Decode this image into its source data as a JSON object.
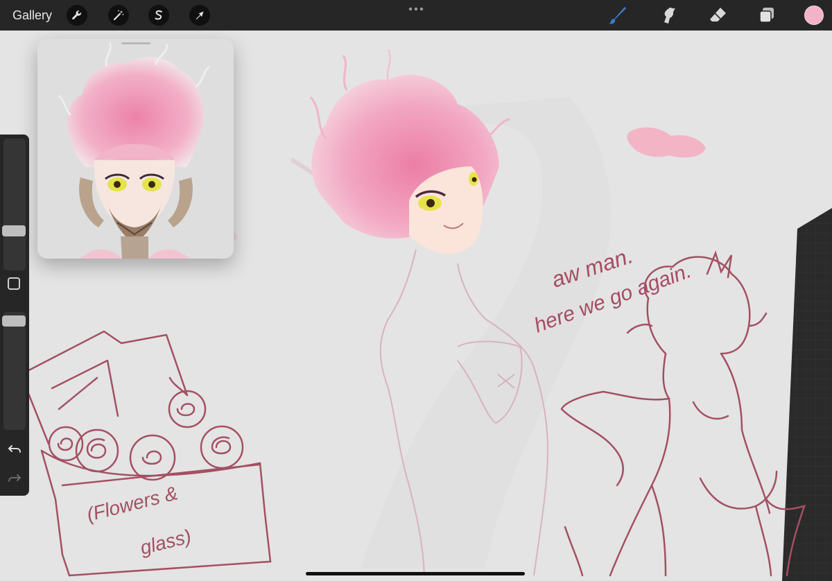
{
  "topbar": {
    "gallery_label": "Gallery",
    "left_tools": [
      "wrench-icon",
      "magic-wand-icon",
      "selection-icon",
      "transform-arrow-icon"
    ],
    "right_tools": [
      "brush-icon",
      "smudge-icon",
      "eraser-icon",
      "layers-icon"
    ],
    "active_tool": "brush-icon"
  },
  "colors": {
    "toolbar_bg": "#262626",
    "active_tool": "#3a7bd5",
    "current_color": "#f2b3c6",
    "canvas_bg": "#e4e4e4",
    "sketch_stroke": "#a35062",
    "hair_pink": "#ee8fb2"
  },
  "canvas": {
    "annotation_line1": "aw man.",
    "annotation_line2": "here we go again.",
    "box_label_line1": "(Flowers &",
    "box_label_line2": "glass)"
  },
  "sidebar": {
    "brush_size_level": 0.28,
    "opacity_level": 0.97,
    "undo_icon": "undo-icon",
    "redo_icon": "redo-icon"
  }
}
